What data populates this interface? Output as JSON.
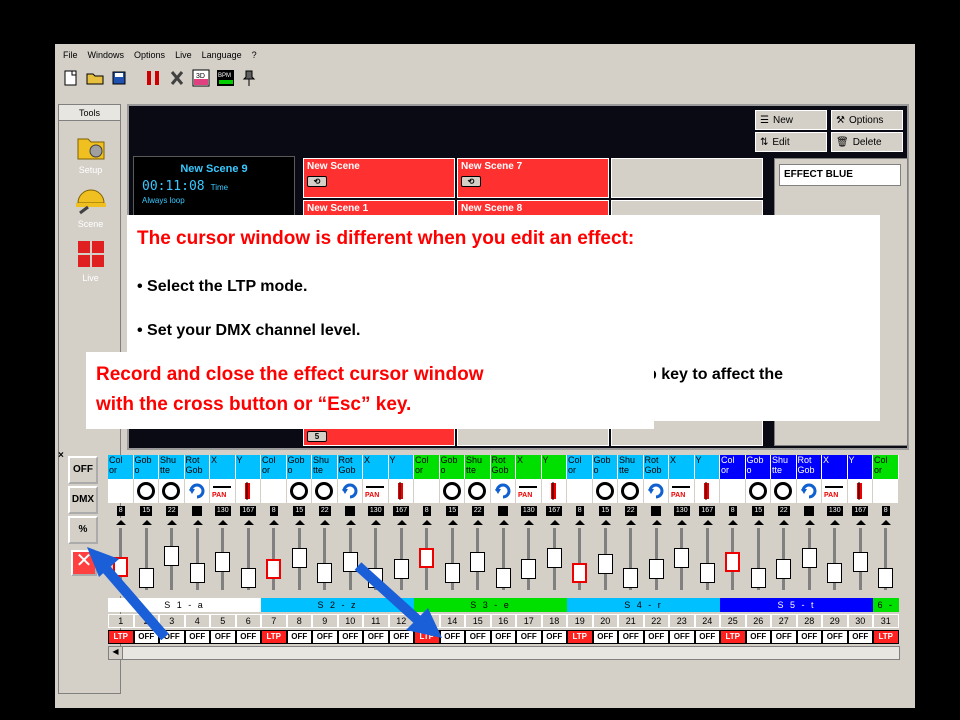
{
  "menu": [
    "File",
    "Windows",
    "Options",
    "Live",
    "Language",
    "?"
  ],
  "toolbar_icons": [
    "new-file-icon",
    "open-folder-icon",
    "save-icon",
    "fixture-icon",
    "tools-icon",
    "3d-icon",
    "bpm-icon",
    "pin-icon"
  ],
  "tools_panel": {
    "header": "Tools",
    "items": [
      {
        "label": "Setup",
        "icon": "setup-icon"
      },
      {
        "label": "Scene",
        "icon": "scene-icon"
      },
      {
        "label": "Live",
        "icon": "live-icon"
      }
    ]
  },
  "scene_panel": {
    "title": "New Scene 9",
    "time_value": "00:11:08",
    "time_label": "Time",
    "loop_text": "Always loop"
  },
  "scene_cells": [
    {
      "label": "New Scene",
      "color": "red"
    },
    {
      "label": "New Scene 7",
      "color": "red"
    },
    {
      "label": "New Scene 1",
      "color": "red"
    },
    {
      "label": "New Scene 8",
      "color": "red"
    }
  ],
  "right_buttons": {
    "new": "New",
    "options": "Options",
    "edit": "Edit",
    "delete": "Delete"
  },
  "effect_name": "EFFECT BLUE",
  "loop_badge": "5",
  "side_buttons": [
    "OFF",
    "DMX",
    "%"
  ],
  "channel_headers": [
    "Col\nor",
    "Gob\no",
    "Shu\ntte",
    "Rot\nGob",
    "X",
    "Y",
    "Col\nor",
    "Gob\no",
    "Shu\ntte",
    "Rot\nGob",
    "X",
    "Y",
    "Col\nor",
    "Gob\no",
    "Shu\ntte",
    "Rot\nGob",
    "X",
    "Y",
    "Col\nor",
    "Gob\no",
    "Shu\ntte",
    "Rot\nGob",
    "X",
    "Y",
    "Col\nor",
    "Gob\no",
    "Shu\ntte",
    "Rot\nGob",
    "X",
    "Y",
    "Col\nor"
  ],
  "header_colors": [
    "#00c0ff",
    "#00c0ff",
    "#00c0ff",
    "#00c0ff",
    "#00c0ff",
    "#00c0ff",
    "#00c0ff",
    "#00c0ff",
    "#00c0ff",
    "#00c0ff",
    "#00c0ff",
    "#00c0ff",
    "#00e000",
    "#00e000",
    "#00e000",
    "#00e000",
    "#00e000",
    "#00e000",
    "#00c0ff",
    "#00c0ff",
    "#00c0ff",
    "#00c0ff",
    "#00c0ff",
    "#00c0ff",
    "#0000ff",
    "#0000ff",
    "#0000ff",
    "#0000ff",
    "#0000ff",
    "#0000ff",
    "#00e000"
  ],
  "values": [
    "8",
    "15",
    "22",
    "",
    "130",
    "167",
    "8",
    "15",
    "22",
    "",
    "130",
    "167",
    "8",
    "15",
    "22",
    "",
    "130",
    "167",
    "8",
    "15",
    "22",
    "",
    "130",
    "167",
    "8",
    "15",
    "22",
    "",
    "130",
    "167",
    "8"
  ],
  "fader_levels": [
    0.35,
    0.1,
    0.6,
    0.2,
    0.45,
    0.1,
    0.3,
    0.55,
    0.2,
    0.45,
    0.1,
    0.3,
    0.55,
    0.2,
    0.45,
    0.1,
    0.3,
    0.55,
    0.2,
    0.4,
    0.1,
    0.3,
    0.55,
    0.2,
    0.45,
    0.1,
    0.3,
    0.55,
    0.2,
    0.45,
    0.1
  ],
  "red_faders": [
    0,
    6,
    12,
    18,
    24
  ],
  "scene_bar": [
    {
      "label": "S 1 - a",
      "color": "#ffffff",
      "span": 6
    },
    {
      "label": "S 2 - z",
      "color": "#00c0ff",
      "span": 6
    },
    {
      "label": "S 3 - e",
      "color": "#00e000",
      "span": 6
    },
    {
      "label": "S 4 - r",
      "color": "#00c0ff",
      "span": 6
    },
    {
      "label": "S 5 - t",
      "color": "#0000ff",
      "span": 6
    },
    {
      "label": "6 -",
      "color": "#00e000",
      "span": 1
    }
  ],
  "channel_numbers": [
    "1",
    "2",
    "3",
    "4",
    "5",
    "6",
    "7",
    "8",
    "9",
    "10",
    "11",
    "12",
    "13",
    "14",
    "15",
    "16",
    "17",
    "18",
    "19",
    "20",
    "21",
    "22",
    "23",
    "24",
    "25",
    "26",
    "27",
    "28",
    "29",
    "30",
    "31"
  ],
  "channel_modes": [
    "LTP",
    "OFF",
    "OFF",
    "OFF",
    "OFF",
    "OFF",
    "LTP",
    "OFF",
    "OFF",
    "OFF",
    "OFF",
    "OFF",
    "LTP",
    "OFF",
    "OFF",
    "OFF",
    "OFF",
    "OFF",
    "LTP",
    "OFF",
    "OFF",
    "OFF",
    "OFF",
    "OFF",
    "LTP",
    "OFF",
    "OFF",
    "OFF",
    "OFF",
    "OFF",
    "LTP"
  ],
  "callout_main": {
    "title": "The cursor window is different when you edit an effect:",
    "bullet1": "• Select the LTP mode.",
    "bullet2": "• Set your DMX channel level.",
    "bullet3_fragment": "p key to affect the"
  },
  "callout_record": {
    "line1": "Record and close the effect cursor window",
    "line2": "with the cross button or “Esc” key."
  }
}
